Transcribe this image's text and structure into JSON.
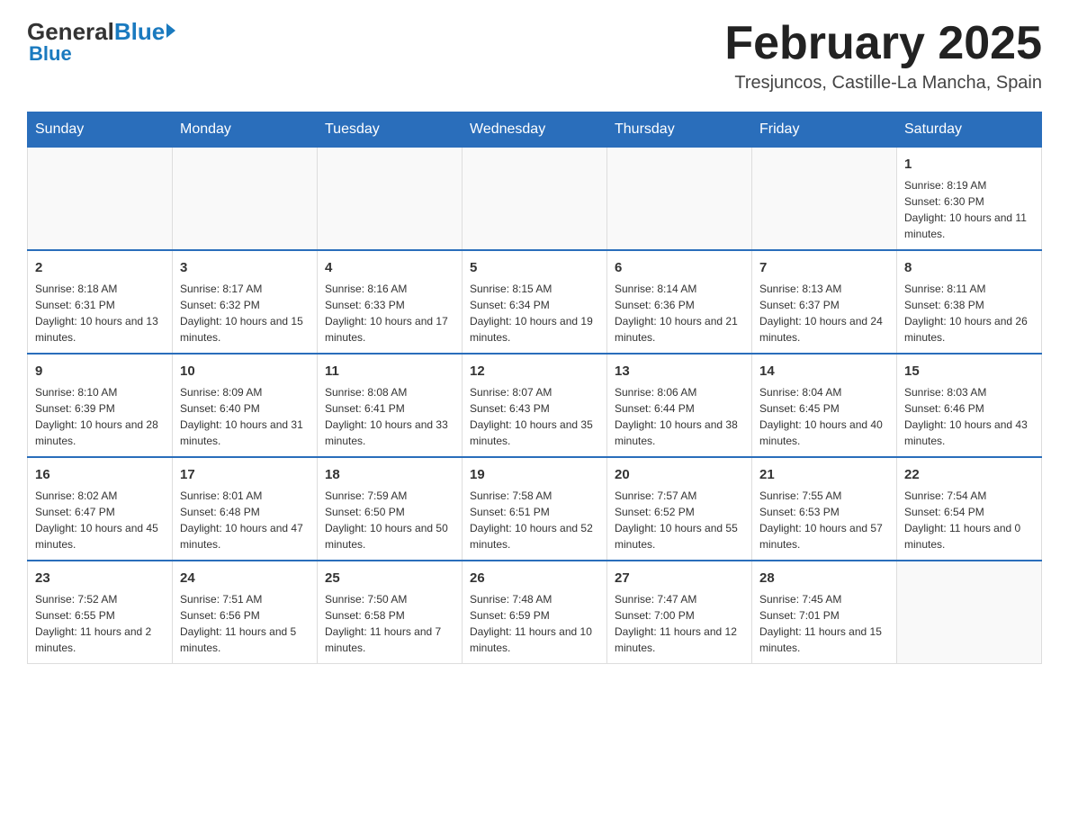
{
  "logo": {
    "general": "General",
    "blue": "Blue"
  },
  "header": {
    "title": "February 2025",
    "location": "Tresjuncos, Castille-La Mancha, Spain"
  },
  "weekdays": [
    "Sunday",
    "Monday",
    "Tuesday",
    "Wednesday",
    "Thursday",
    "Friday",
    "Saturday"
  ],
  "weeks": [
    [
      {
        "day": "",
        "info": ""
      },
      {
        "day": "",
        "info": ""
      },
      {
        "day": "",
        "info": ""
      },
      {
        "day": "",
        "info": ""
      },
      {
        "day": "",
        "info": ""
      },
      {
        "day": "",
        "info": ""
      },
      {
        "day": "1",
        "info": "Sunrise: 8:19 AM\nSunset: 6:30 PM\nDaylight: 10 hours and 11 minutes."
      }
    ],
    [
      {
        "day": "2",
        "info": "Sunrise: 8:18 AM\nSunset: 6:31 PM\nDaylight: 10 hours and 13 minutes."
      },
      {
        "day": "3",
        "info": "Sunrise: 8:17 AM\nSunset: 6:32 PM\nDaylight: 10 hours and 15 minutes."
      },
      {
        "day": "4",
        "info": "Sunrise: 8:16 AM\nSunset: 6:33 PM\nDaylight: 10 hours and 17 minutes."
      },
      {
        "day": "5",
        "info": "Sunrise: 8:15 AM\nSunset: 6:34 PM\nDaylight: 10 hours and 19 minutes."
      },
      {
        "day": "6",
        "info": "Sunrise: 8:14 AM\nSunset: 6:36 PM\nDaylight: 10 hours and 21 minutes."
      },
      {
        "day": "7",
        "info": "Sunrise: 8:13 AM\nSunset: 6:37 PM\nDaylight: 10 hours and 24 minutes."
      },
      {
        "day": "8",
        "info": "Sunrise: 8:11 AM\nSunset: 6:38 PM\nDaylight: 10 hours and 26 minutes."
      }
    ],
    [
      {
        "day": "9",
        "info": "Sunrise: 8:10 AM\nSunset: 6:39 PM\nDaylight: 10 hours and 28 minutes."
      },
      {
        "day": "10",
        "info": "Sunrise: 8:09 AM\nSunset: 6:40 PM\nDaylight: 10 hours and 31 minutes."
      },
      {
        "day": "11",
        "info": "Sunrise: 8:08 AM\nSunset: 6:41 PM\nDaylight: 10 hours and 33 minutes."
      },
      {
        "day": "12",
        "info": "Sunrise: 8:07 AM\nSunset: 6:43 PM\nDaylight: 10 hours and 35 minutes."
      },
      {
        "day": "13",
        "info": "Sunrise: 8:06 AM\nSunset: 6:44 PM\nDaylight: 10 hours and 38 minutes."
      },
      {
        "day": "14",
        "info": "Sunrise: 8:04 AM\nSunset: 6:45 PM\nDaylight: 10 hours and 40 minutes."
      },
      {
        "day": "15",
        "info": "Sunrise: 8:03 AM\nSunset: 6:46 PM\nDaylight: 10 hours and 43 minutes."
      }
    ],
    [
      {
        "day": "16",
        "info": "Sunrise: 8:02 AM\nSunset: 6:47 PM\nDaylight: 10 hours and 45 minutes."
      },
      {
        "day": "17",
        "info": "Sunrise: 8:01 AM\nSunset: 6:48 PM\nDaylight: 10 hours and 47 minutes."
      },
      {
        "day": "18",
        "info": "Sunrise: 7:59 AM\nSunset: 6:50 PM\nDaylight: 10 hours and 50 minutes."
      },
      {
        "day": "19",
        "info": "Sunrise: 7:58 AM\nSunset: 6:51 PM\nDaylight: 10 hours and 52 minutes."
      },
      {
        "day": "20",
        "info": "Sunrise: 7:57 AM\nSunset: 6:52 PM\nDaylight: 10 hours and 55 minutes."
      },
      {
        "day": "21",
        "info": "Sunrise: 7:55 AM\nSunset: 6:53 PM\nDaylight: 10 hours and 57 minutes."
      },
      {
        "day": "22",
        "info": "Sunrise: 7:54 AM\nSunset: 6:54 PM\nDaylight: 11 hours and 0 minutes."
      }
    ],
    [
      {
        "day": "23",
        "info": "Sunrise: 7:52 AM\nSunset: 6:55 PM\nDaylight: 11 hours and 2 minutes."
      },
      {
        "day": "24",
        "info": "Sunrise: 7:51 AM\nSunset: 6:56 PM\nDaylight: 11 hours and 5 minutes."
      },
      {
        "day": "25",
        "info": "Sunrise: 7:50 AM\nSunset: 6:58 PM\nDaylight: 11 hours and 7 minutes."
      },
      {
        "day": "26",
        "info": "Sunrise: 7:48 AM\nSunset: 6:59 PM\nDaylight: 11 hours and 10 minutes."
      },
      {
        "day": "27",
        "info": "Sunrise: 7:47 AM\nSunset: 7:00 PM\nDaylight: 11 hours and 12 minutes."
      },
      {
        "day": "28",
        "info": "Sunrise: 7:45 AM\nSunset: 7:01 PM\nDaylight: 11 hours and 15 minutes."
      },
      {
        "day": "",
        "info": ""
      }
    ]
  ]
}
